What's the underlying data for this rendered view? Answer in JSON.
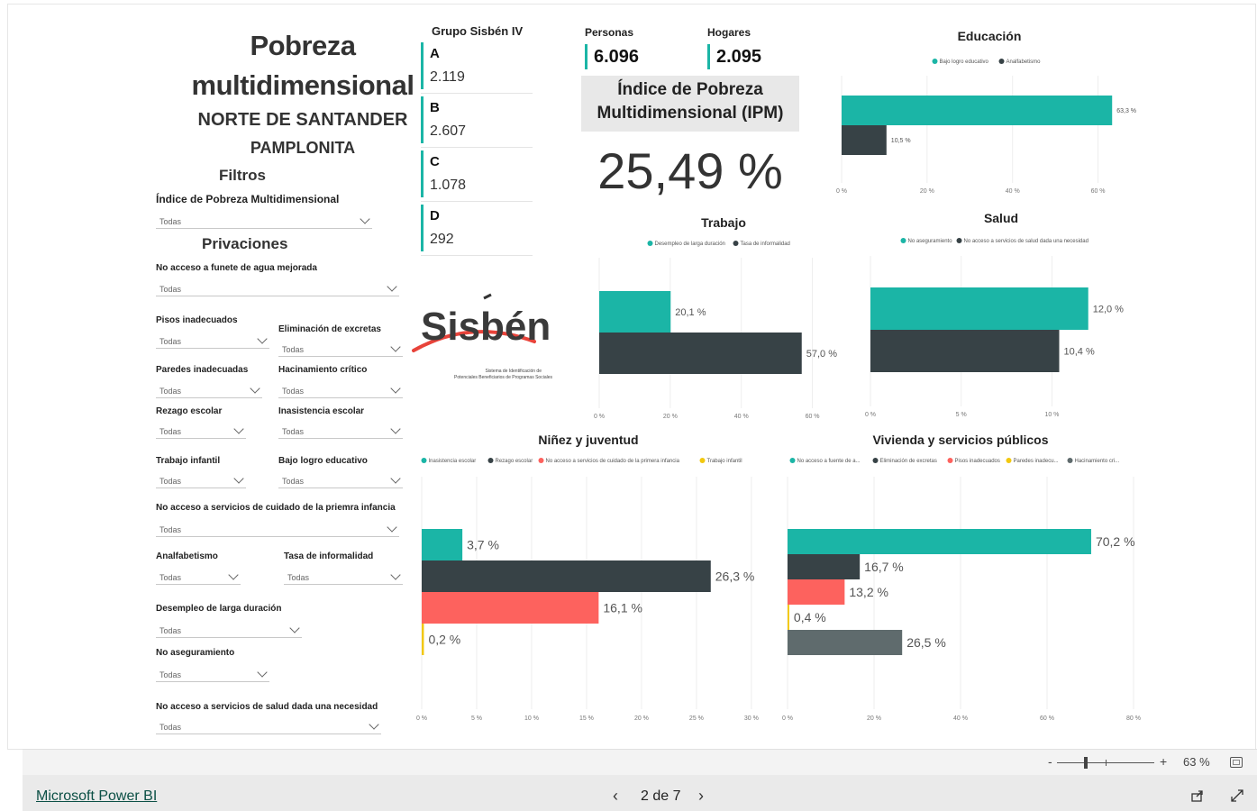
{
  "header": {
    "title_line1": "Pobreza",
    "title_line2": "multidimensional",
    "department": "NORTE DE SANTANDER",
    "municipality": "PAMPLONITA"
  },
  "filters": {
    "heading": "Filtros",
    "ipm_label": "Índice de Pobreza Multidimensional",
    "ipm_value": "Todas",
    "privations_heading": "Privaciones",
    "items": [
      {
        "label": "No acceso a funete de agua mejorada",
        "value": "Todas"
      },
      {
        "label": "Pisos inadecuados",
        "value": "Todas"
      },
      {
        "label": "Eliminación de excretas",
        "value": "Todas"
      },
      {
        "label": "Paredes inadecuadas",
        "value": "Todas"
      },
      {
        "label": "Hacinamiento crítico",
        "value": "Todas"
      },
      {
        "label": "Rezago escolar",
        "value": "Todas"
      },
      {
        "label": "Inasistencia escolar",
        "value": "Todas"
      },
      {
        "label": "Trabajo infantil",
        "value": "Todas"
      },
      {
        "label": "Bajo logro educativo",
        "value": "Todas"
      },
      {
        "label": "No acceso a servicios de cuidado de la priemra infancia",
        "value": "Todas"
      },
      {
        "label": "Analfabetismo",
        "value": "Todas"
      },
      {
        "label": "Tasa de informalidad",
        "value": "Todas"
      },
      {
        "label": "Desempleo de larga duración",
        "value": "Todas"
      },
      {
        "label": "No aseguramiento",
        "value": "Todas"
      },
      {
        "label": "No acceso a servicios de salud dada una necesidad",
        "value": "Todas"
      }
    ]
  },
  "sisben": {
    "title": "Grupo Sisbén IV",
    "groups": [
      {
        "letter": "A",
        "value": "2.119"
      },
      {
        "letter": "B",
        "value": "2.607"
      },
      {
        "letter": "C",
        "value": "1.078"
      },
      {
        "letter": "D",
        "value": "292"
      }
    ],
    "logo_text": "Sisbén",
    "logo_caption_1": "Sistema de Identificación de",
    "logo_caption_2": "Potenciales Beneficiarios de Programas Sociales"
  },
  "kpis": {
    "personas_label": "Personas",
    "personas_value": "6.096",
    "hogares_label": "Hogares",
    "hogares_value": "2.095",
    "ipm_title_1": "Índice de Pobreza",
    "ipm_title_2": "Multidimensional (IPM)",
    "ipm_value": "25,49 %"
  },
  "colors": {
    "teal": "#1bb5a6",
    "dark": "#374246",
    "red": "#fd625e",
    "yellow": "#f2c80f",
    "gray": "#5f6b6d"
  },
  "chart_data": [
    {
      "id": "educacion",
      "type": "bar",
      "title": "Educación",
      "series": [
        {
          "name": "Bajo logro educativo",
          "value": 63.3,
          "label": "63,3 %",
          "color": "#1bb5a6"
        },
        {
          "name": "Analfabetismo",
          "value": 10.5,
          "label": "10,5 %",
          "color": "#374246"
        }
      ],
      "xlim": [
        0,
        70
      ],
      "ticks": [
        0,
        20,
        40,
        60
      ],
      "tick_labels": [
        "0 %",
        "20 %",
        "40 %",
        "60 %"
      ]
    },
    {
      "id": "trabajo",
      "type": "bar",
      "title": "Trabajo",
      "series": [
        {
          "name": "Desempleo de larga duración",
          "value": 20.1,
          "label": "20,1 %",
          "color": "#1bb5a6"
        },
        {
          "name": "Tasa de informalidad",
          "value": 57.0,
          "label": "57,0 %",
          "color": "#374246"
        }
      ],
      "xlim": [
        0,
        70
      ],
      "ticks": [
        0,
        20,
        40,
        60
      ],
      "tick_labels": [
        "0 %",
        "20 %",
        "40 %",
        "60 %"
      ]
    },
    {
      "id": "salud",
      "type": "bar",
      "title": "Salud",
      "series": [
        {
          "name": "No aseguramiento",
          "value": 12.0,
          "label": "12,0 %",
          "color": "#1bb5a6"
        },
        {
          "name": "No acceso a servicios de salud dada una necesidad",
          "value": 10.4,
          "label": "10,4 %",
          "color": "#374246"
        }
      ],
      "xlim": [
        0,
        14
      ],
      "ticks": [
        0,
        5,
        10
      ],
      "tick_labels": [
        "0 %",
        "5 %",
        "10 %"
      ]
    },
    {
      "id": "ninez",
      "type": "bar",
      "title": "Niñez y juventud",
      "series": [
        {
          "name": "Inasistencia escolar",
          "value": 3.7,
          "label": "3,7 %",
          "color": "#1bb5a6"
        },
        {
          "name": "Rezago escolar",
          "value": 26.3,
          "label": "26,3 %",
          "color": "#374246"
        },
        {
          "name": "No acceso a servicios de cuidado de la primera infancia",
          "value": 16.1,
          "label": "16,1 %",
          "color": "#fd625e"
        },
        {
          "name": "Trabajo infantil",
          "value": 0.2,
          "label": "0,2 %",
          "color": "#f2c80f"
        }
      ],
      "xlim": [
        0,
        30.5
      ],
      "ticks": [
        0,
        5,
        10,
        15,
        20,
        25,
        30
      ],
      "tick_labels": [
        "0 %",
        "5 %",
        "10 %",
        "15 %",
        "20 %",
        "25 %",
        "30 %"
      ]
    },
    {
      "id": "vivienda",
      "type": "bar",
      "title": "Vivienda y servicios públicos",
      "series": [
        {
          "name": "No acceso a fuente de a...",
          "value": 70.2,
          "label": "70,2 %",
          "color": "#1bb5a6"
        },
        {
          "name": "Eliminación de excretas",
          "value": 16.7,
          "label": "16,7 %",
          "color": "#374246"
        },
        {
          "name": "Pisos inadecuados",
          "value": 13.2,
          "label": "13,2 %",
          "color": "#fd625e"
        },
        {
          "name": "Paredes inadecu...",
          "value": 0.4,
          "label": "0,4 %",
          "color": "#f2c80f"
        },
        {
          "name": "Hacinamiento cri...",
          "value": 26.5,
          "label": "26,5 %",
          "color": "#5f6b6d"
        }
      ],
      "xlim": [
        0,
        80
      ],
      "ticks": [
        0,
        20,
        40,
        60,
        80
      ],
      "tick_labels": [
        "0 %",
        "20 %",
        "40 %",
        "60 %",
        "80 %"
      ]
    }
  ],
  "footer": {
    "zoom_minus": "-",
    "zoom_plus": "+",
    "zoom_level": "63 %",
    "brand_link": "Microsoft Power BI",
    "page_indicator": "2 de 7",
    "zoom_fraction": 0.3
  }
}
